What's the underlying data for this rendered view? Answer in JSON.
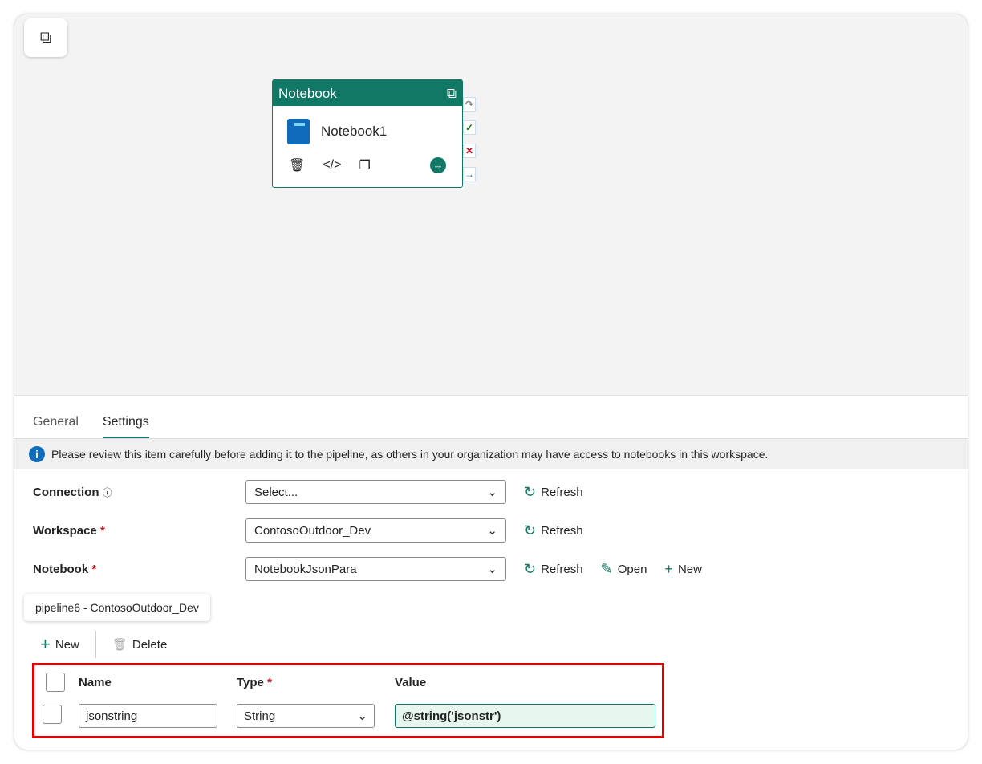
{
  "node": {
    "title": "Notebook",
    "name": "Notebook1"
  },
  "tabs": [
    "General",
    "Settings"
  ],
  "banner": "Please review this item carefully before adding it to the pipeline, as others in your organization may have access to notebooks in this workspace.",
  "fields": {
    "connection": {
      "label": "Connection",
      "value": "Select...",
      "refresh": "Refresh"
    },
    "workspace": {
      "label": "Workspace",
      "value": "ContosoOutdoor_Dev",
      "refresh": "Refresh"
    },
    "notebook": {
      "label": "Notebook",
      "value": "NotebookJsonPara",
      "refresh": "Refresh",
      "open": "Open",
      "new": "New"
    }
  },
  "tooltip": "pipeline6 - ContosoOutdoor_Dev",
  "toolbar": {
    "new": "New",
    "delete": "Delete"
  },
  "params": {
    "headers": [
      "Name",
      "Type",
      "Value"
    ],
    "rows": [
      {
        "name": "jsonstring",
        "type": "String",
        "value": "@string('jsonstr')"
      }
    ]
  }
}
